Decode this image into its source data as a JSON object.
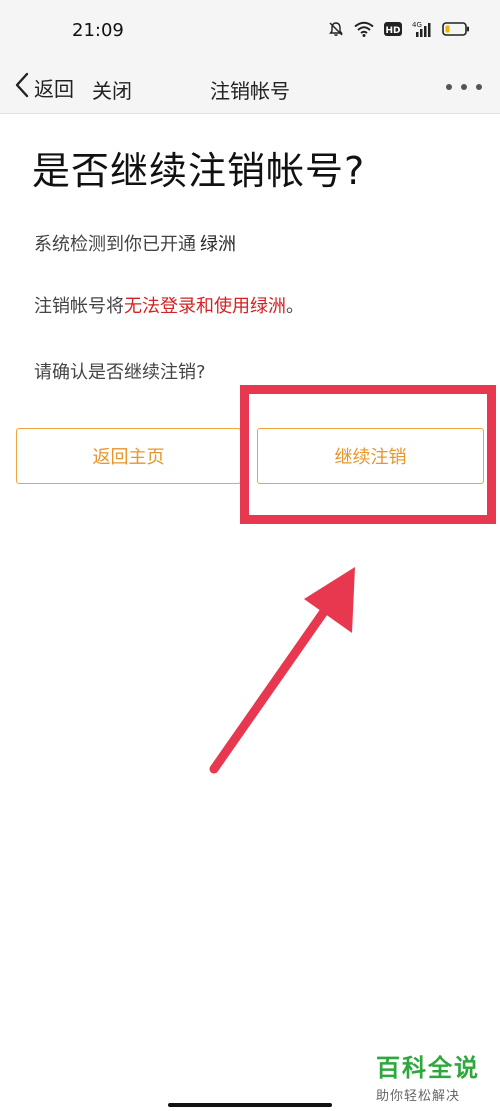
{
  "status_bar": {
    "time": "21:09",
    "icons": [
      "mute-bell-icon",
      "wifi-icon",
      "hd-icon",
      "4g-signal-icon",
      "battery-icon"
    ],
    "hd_label": "HD",
    "network_label": "4G"
  },
  "nav": {
    "back_label": "返回",
    "close_label": "关闭",
    "title": "注销帐号"
  },
  "content": {
    "heading": "是否继续注销帐号?",
    "detect_prefix": "系统检测到你已开通",
    "app_name": "绿洲",
    "warning_prefix": "注销帐号将",
    "warning_highlight": "无法登录和使用绿洲",
    "warning_suffix": "。",
    "confirm_question": "请确认是否继续注销?"
  },
  "buttons": {
    "home_label": "返回主页",
    "continue_label": "继续注销"
  },
  "watermark": {
    "main": "百科全说",
    "sub": "助你轻松解决"
  },
  "colors": {
    "accent_orange": "#f0a43b",
    "warning_red": "#d42222",
    "annotation_red": "#e8384f",
    "watermark_green": "#2ea83e"
  }
}
